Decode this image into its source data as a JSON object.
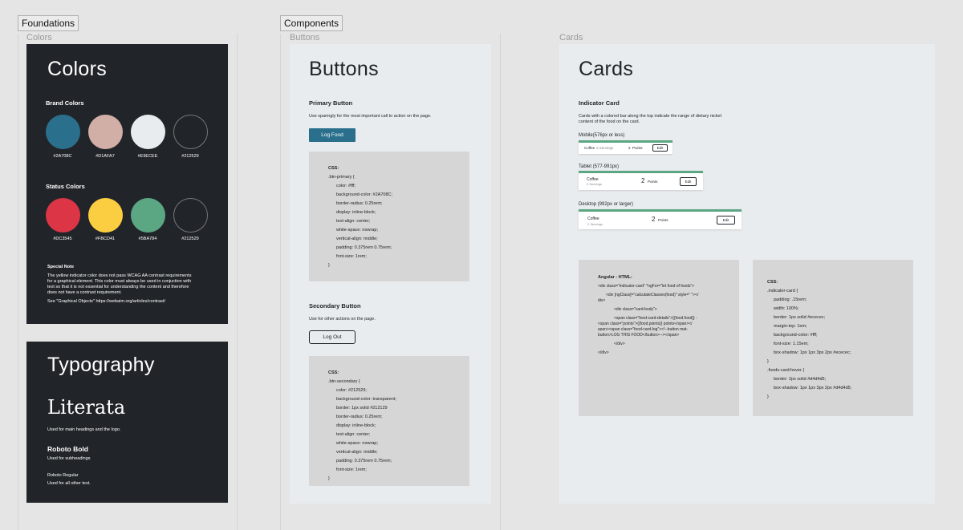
{
  "sections": {
    "foundations": "Foundations",
    "components": "Components"
  },
  "frames": {
    "colors": "Colors",
    "buttons": "Buttons",
    "cards": "Cards"
  },
  "colors_panel": {
    "title": "Colors",
    "brand_heading": "Brand Colors",
    "brand": [
      {
        "hex": "#2A708C",
        "color": "#2a708c"
      },
      {
        "hex": "#D1AFA7",
        "color": "#d1afa7"
      },
      {
        "hex": "#E9ECEE",
        "color": "#e9ecee"
      },
      {
        "hex": "#212529",
        "color": "#212529"
      }
    ],
    "status_heading": "Status Colors",
    "status": [
      {
        "hex": "#DC3545",
        "color": "#dc3545"
      },
      {
        "hex": "#FBCD41",
        "color": "#fbcd41"
      },
      {
        "hex": "#5BA784",
        "color": "#5ba784"
      },
      {
        "hex": "#212529",
        "color": "#212529"
      }
    ],
    "note_title": "Special Note",
    "note_lines": [
      "The yellow indicator color does not pass WCAG AA contrast requirements",
      "for a graphical element. This color must always be used in conjuction with",
      "text so that it is not essential for understanding the content and therefore",
      "does not have a contrast requirement."
    ],
    "note_see": "See \"Graphical Objects\" https://webaim.org/articles/contrast/"
  },
  "typography_panel": {
    "title": "Typography",
    "literata": "Literata",
    "literata_desc": "Used for main headings and the logo.",
    "roboto_bold": "Roboto Bold",
    "roboto_bold_desc": "Used for subheadings",
    "roboto_regular": "Roboto Regular",
    "roboto_regular_desc": "Used for all other text."
  },
  "buttons_panel": {
    "title": "Buttons",
    "primary_heading": "Primary Button",
    "primary_desc": "Use sparingly for the most important call to action on the page.",
    "primary_label": "Log Food",
    "primary_css": [
      "CSS:",
      ".btn-primary {",
      "color: #fff;",
      "background-color: #2A708C;",
      "border-radius: 0.25rem;",
      "display: inline-block;",
      "text-align: center;",
      "white-space: nowrap;",
      "vertical-align: middle;",
      "padding: 0.375rem 0.75rem;",
      "font-size: 1rem;",
      "}"
    ],
    "secondary_heading": "Secondary Button",
    "secondary_desc": "Use for other actions on the page.",
    "secondary_label": "Log Out",
    "secondary_css": [
      "CSS:",
      ".btn-secondary {",
      "color: #212529;",
      "background-color: transparent;",
      "border: 1px solid #212129",
      "border-radius: 0.25rem;",
      "display: inline-block;",
      "text-align: center;",
      "white-space: nowrap;",
      "vertical-align: middle;",
      "padding: 0.375rem 0.75rem;",
      "font-size: 1rem;",
      "}"
    ]
  },
  "cards_panel": {
    "title": "Cards",
    "indicator_heading": "Indicator Card",
    "indicator_desc": [
      "Cards with a colored bar along the top indicate the range of dietary nickel",
      "content of the food on the card."
    ],
    "mobile_label": "Mobile(576px or less)",
    "tablet_label": "Tablet (577-991px)",
    "desktop_label": "Desktop (992px or larger)",
    "card_food": "Coffee",
    "card_servings": "2 Servings",
    "card_points_value": "2",
    "card_points_label": "Points",
    "card_edit": "Edit",
    "html_code": [
      "Angular - HTML:",
      "<div class=\"indicator-card\" *ngFor=\"let food of foods\">",
      "<div [ngClass]=\"calculateClasses(food)\" style=\" \"></",
      "div>",
      "<div class=\"card-body\">",
      "<span class=\"food-card-details\">{{food.food}} -",
      "<span class=\"points\">{{food.points}} points</span></",
      "span><span class=\"food-card-log\"><!--button mat-",
      "button>LOG THIS FOOD</button>--></span>",
      "</div>",
      "</div>"
    ],
    "card_css": [
      "CSS:",
      ".indicator-card {",
      "padding: .15rem;",
      "width: 100%;",
      "border: 1px solid #ececec;",
      "margin-top: 1em;",
      "background-color: #fff;",
      "font-size: 1.15em;",
      "box-shadow: 1px 1px 3px 2px #ececec;",
      "}",
      ".foods-card:hover {",
      "border: 2px solid #d4d4d5;",
      "box-shadow: 1px 1px 3px 2px #d4d4d5;",
      "}"
    ]
  }
}
